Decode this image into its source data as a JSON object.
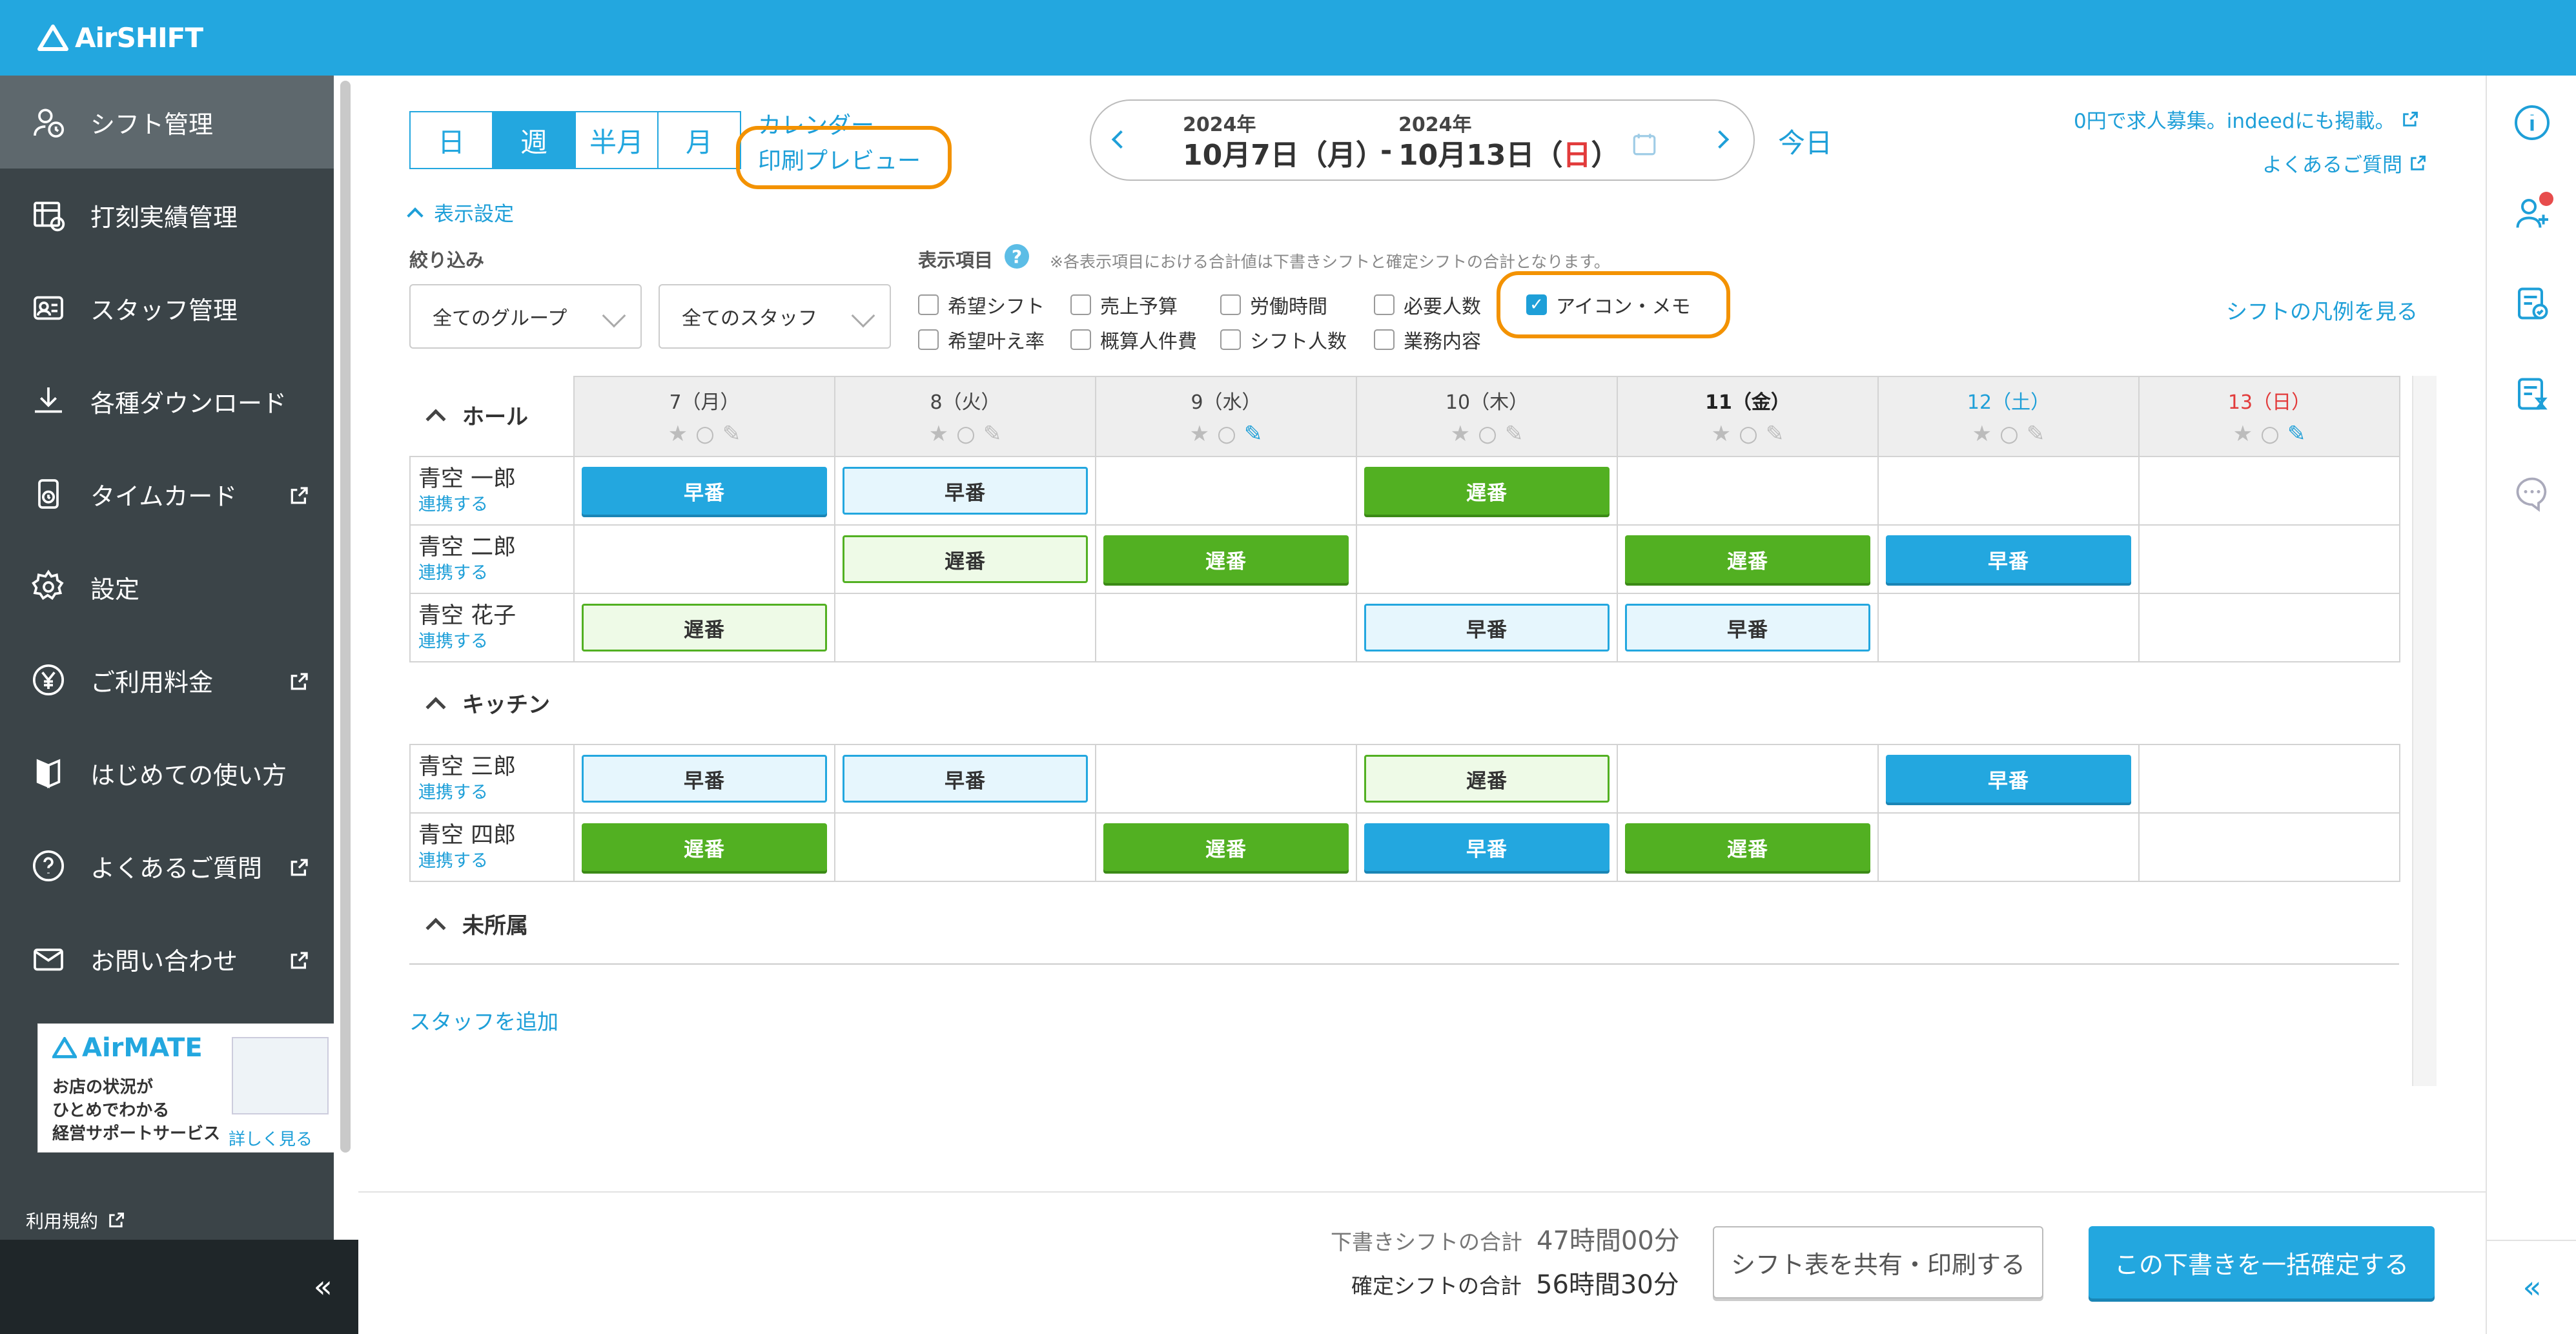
{
  "app": {
    "logo": "AirSHIFT"
  },
  "sidebar": {
    "items": [
      {
        "label": "シフト管理",
        "icon": "user-clock-icon",
        "external": false,
        "active": true
      },
      {
        "label": "打刻実績管理",
        "icon": "timesheet-icon",
        "external": false
      },
      {
        "label": "スタッフ管理",
        "icon": "staff-id-icon",
        "external": false
      },
      {
        "label": "各種ダウンロード",
        "icon": "download-icon",
        "external": false
      },
      {
        "label": "タイムカード",
        "icon": "timecard-icon",
        "external": true
      },
      {
        "label": "設定",
        "icon": "gear-icon",
        "external": false
      },
      {
        "label": "ご利用料金",
        "icon": "yen-icon",
        "external": true
      },
      {
        "label": "はじめての使い方",
        "icon": "guide-icon",
        "external": false
      },
      {
        "label": "よくあるご質問",
        "icon": "question-icon",
        "external": true
      },
      {
        "label": "お問い合わせ",
        "icon": "mail-icon",
        "external": true
      }
    ],
    "ad": {
      "brand": "AirMATE",
      "line1": "お店の状況が",
      "line2": "ひとめでわかる",
      "line3": "経営サポートサービス",
      "link": "詳しく見る"
    },
    "terms": "利用規約",
    "collapse": "«"
  },
  "toolbar": {
    "view_buttons": [
      "日",
      "週",
      "半月",
      "月"
    ],
    "active_view": "週",
    "calendar_link": "カレンダー",
    "print_preview": "印刷プレビュー",
    "date_from_year": "2024年",
    "date_from": "10月7日（月）",
    "date_sep": "-",
    "date_to_year": "2024年",
    "date_to_prefix": "10月13日（",
    "date_to_day": "日",
    "date_to_suffix": "）",
    "today": "今日",
    "job_ad": "0円で求人募集。indeedにも掲載。",
    "faq": "よくあるご質問"
  },
  "display_settings": {
    "toggle": "表示設定",
    "filter_label": "絞り込み",
    "group_select": "全てのグループ",
    "staff_select": "全てのスタッフ",
    "items_label": "表示項目",
    "items_note": "※各表示項目における合計値は下書きシフトと確定シフトの合計となります。",
    "checkboxes": [
      {
        "label": "希望シフト",
        "checked": false
      },
      {
        "label": "売上予算",
        "checked": false
      },
      {
        "label": "労働時間",
        "checked": false
      },
      {
        "label": "必要人数",
        "checked": false
      },
      {
        "label": "アイコン・メモ",
        "checked": true
      },
      {
        "label": "希望叶え率",
        "checked": false
      },
      {
        "label": "概算人件費",
        "checked": false
      },
      {
        "label": "シフト人数",
        "checked": false
      },
      {
        "label": "業務内容",
        "checked": false
      }
    ],
    "legend_link": "シフトの凡例を見る"
  },
  "days": [
    {
      "label": "7（月）",
      "color": "#444444",
      "memo": false
    },
    {
      "label": "8（火）",
      "color": "#444444",
      "memo": false
    },
    {
      "label": "9（水）",
      "color": "#444444",
      "memo": true
    },
    {
      "label": "10（木）",
      "color": "#444444",
      "memo": false
    },
    {
      "label": "11（金）",
      "color": "#222222",
      "memo": false,
      "bold": true
    },
    {
      "label": "12（土）",
      "color": "#1e9fd8",
      "memo": false
    },
    {
      "label": "13（日）",
      "color": "#e23b3b",
      "memo": true
    }
  ],
  "groups": [
    {
      "name": "ホール",
      "staff": [
        {
          "name": "青空 一郎",
          "link": "連携する",
          "shifts": [
            [
              "早番",
              "blue"
            ],
            [
              "早番",
              "lblue"
            ],
            null,
            [
              "遅番",
              "green"
            ],
            null,
            null,
            null
          ]
        },
        {
          "name": "青空 二郎",
          "link": "連携する",
          "shifts": [
            null,
            [
              "遅番",
              "lgreen"
            ],
            [
              "遅番",
              "green"
            ],
            null,
            [
              "遅番",
              "green"
            ],
            [
              "早番",
              "blue"
            ],
            null
          ]
        },
        {
          "name": "青空 花子",
          "link": "連携する",
          "shifts": [
            [
              "遅番",
              "lgreen"
            ],
            null,
            null,
            [
              "早番",
              "lblue"
            ],
            [
              "早番",
              "lblue"
            ],
            null,
            null
          ]
        }
      ]
    },
    {
      "name": "キッチン",
      "staff": [
        {
          "name": "青空 三郎",
          "link": "連携する",
          "shifts": [
            [
              "早番",
              "lblue"
            ],
            [
              "早番",
              "lblue"
            ],
            null,
            [
              "遅番",
              "lgreen"
            ],
            null,
            [
              "早番",
              "blue"
            ],
            null
          ]
        },
        {
          "name": "青空 四郎",
          "link": "連携する",
          "shifts": [
            [
              "遅番",
              "green"
            ],
            null,
            [
              "遅番",
              "green"
            ],
            [
              "早番",
              "blue"
            ],
            [
              "遅番",
              "green"
            ],
            null,
            null
          ]
        }
      ]
    },
    {
      "name": "未所属",
      "staff": []
    }
  ],
  "add_staff": "スタッフを追加",
  "footer": {
    "draft_label": "下書きシフトの合計",
    "draft_value": "47時間00分",
    "confirmed_label": "確定シフトの合計",
    "confirmed_value": "56時間30分",
    "share_button": "シフト表を共有・印刷する",
    "confirm_button": "この下書きを一括確定する"
  },
  "colors": {
    "accent": "#23a7df",
    "green": "#52b022",
    "sidebar": "#3b4448",
    "highlight": "#f39200"
  }
}
